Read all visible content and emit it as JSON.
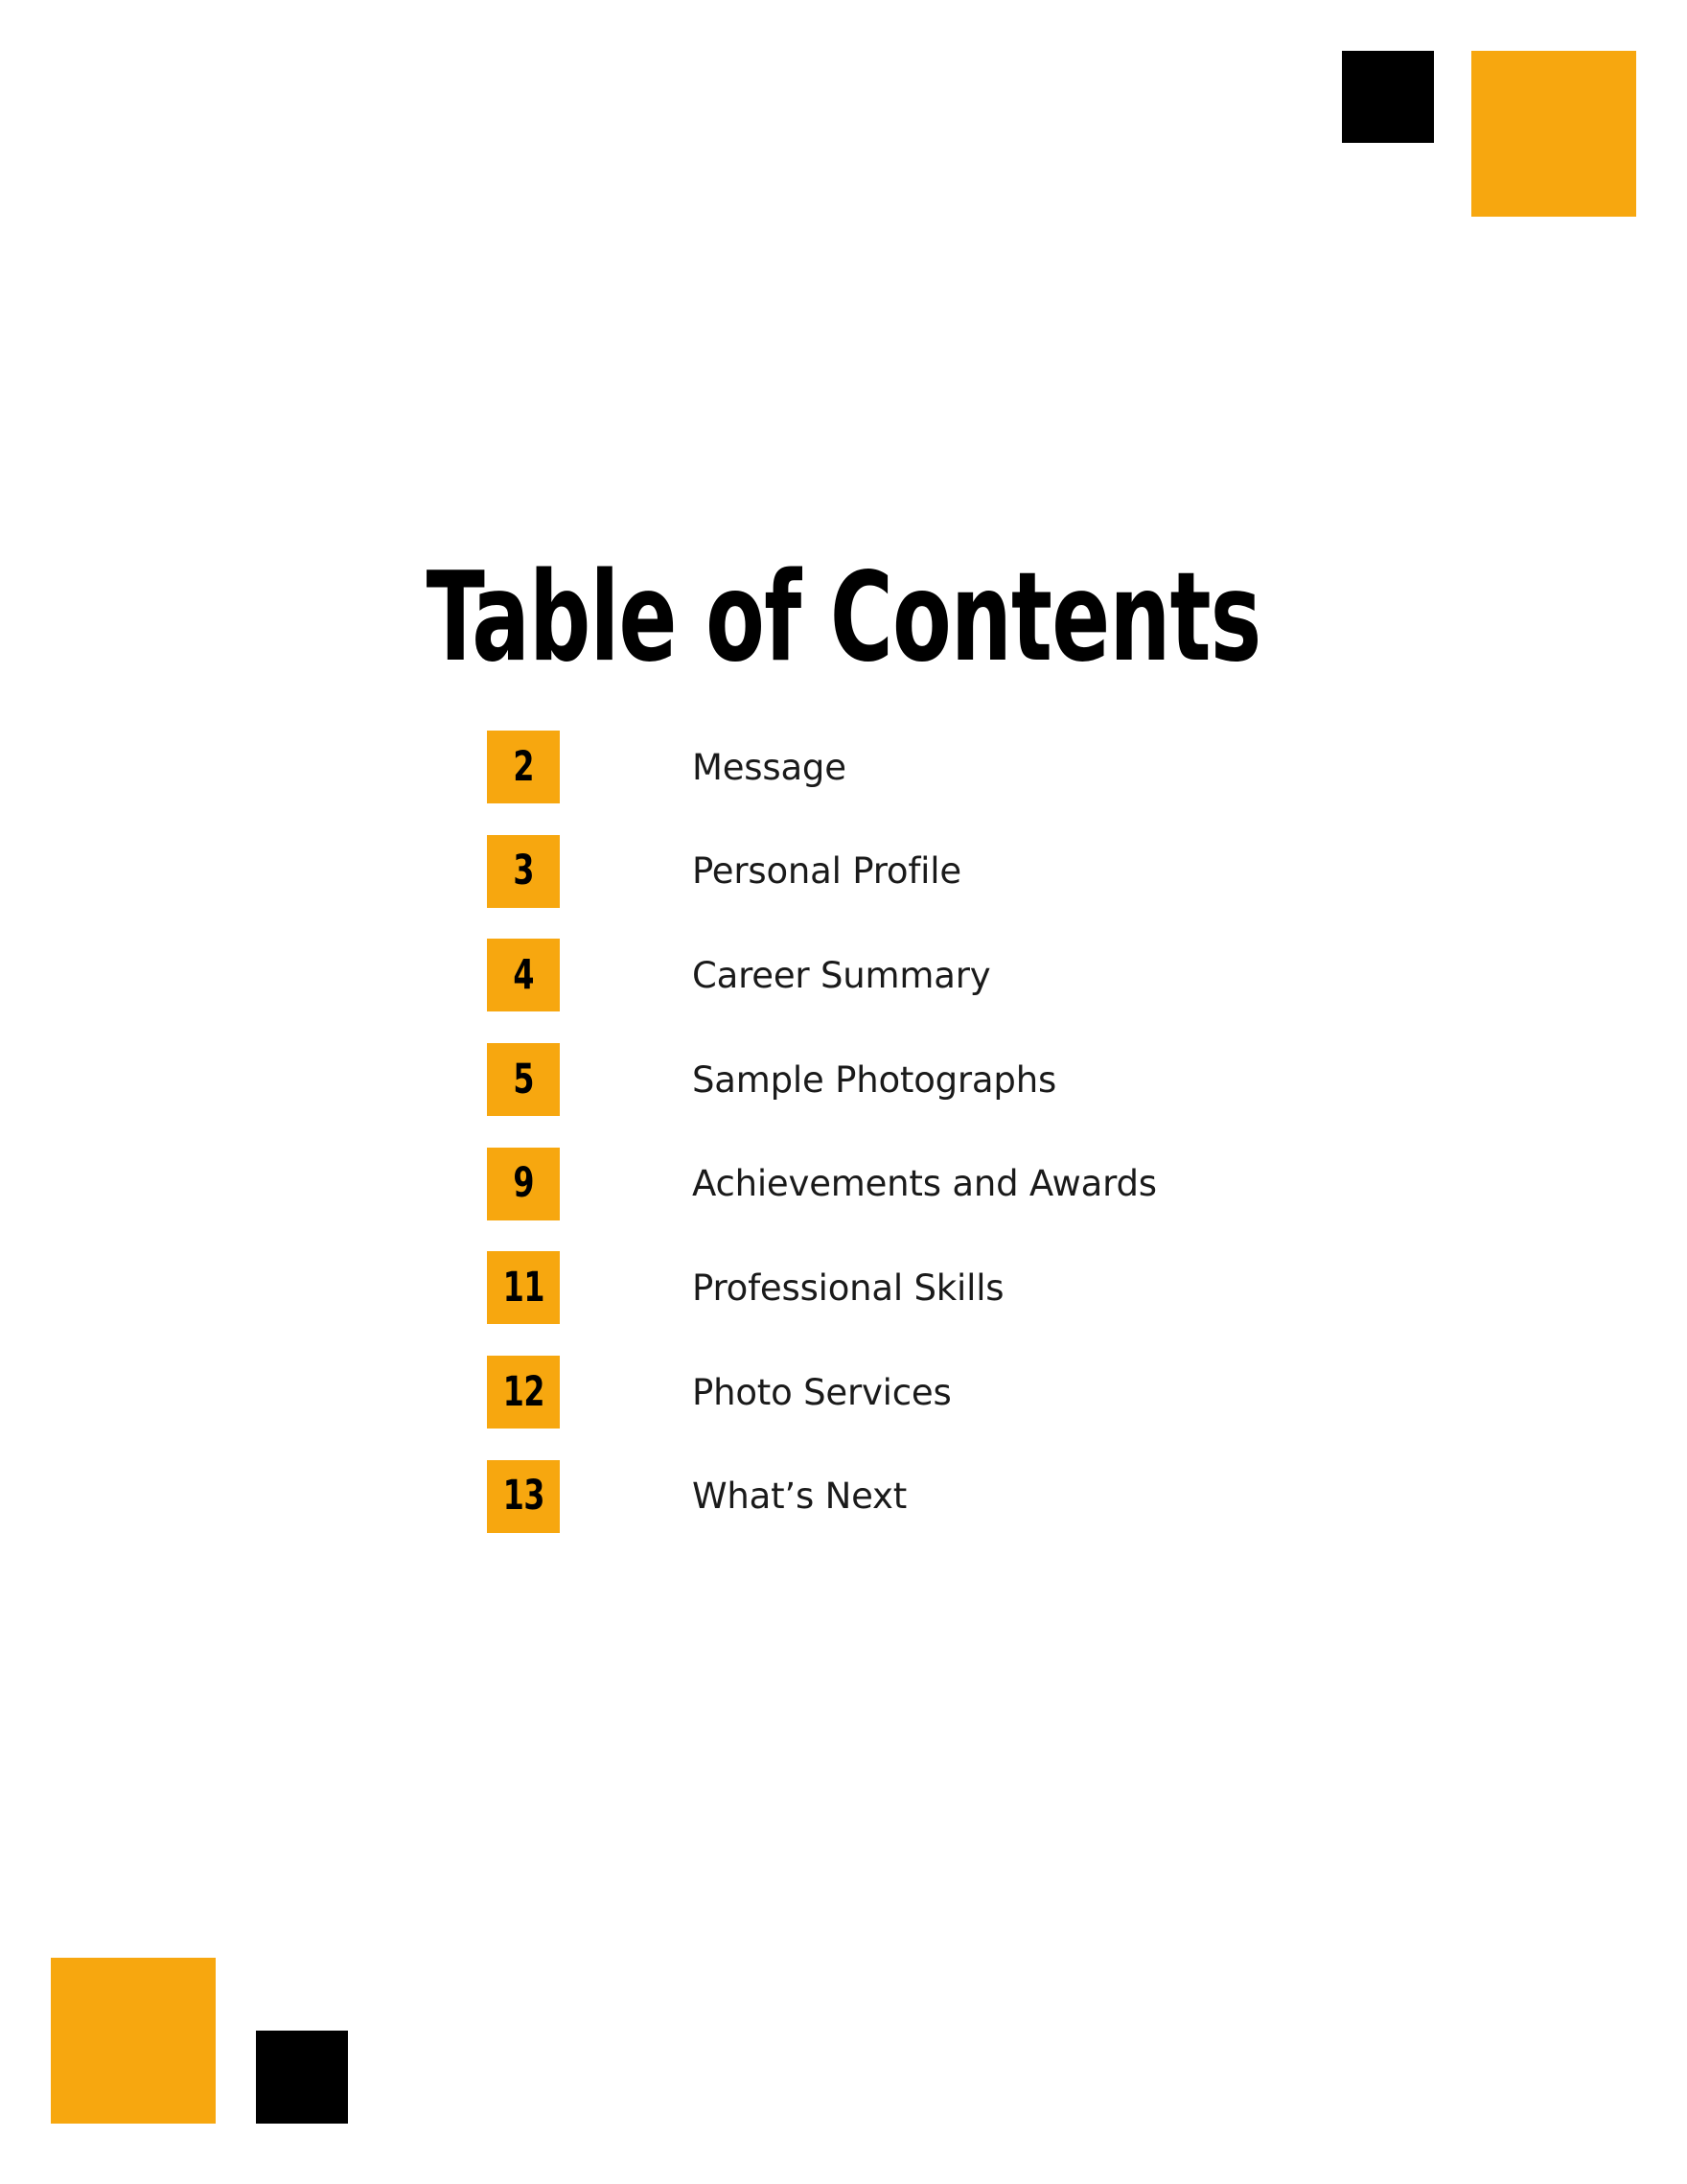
{
  "document": {
    "title": "Table of Contents",
    "background_color": "#FFFFFF"
  },
  "theme": {
    "accent_color": "#F7A70F",
    "dark_color": "#000000",
    "text_color": "#1A1A1A"
  },
  "decorations": [
    {
      "name": "top-right-black-square",
      "color": "#000000"
    },
    {
      "name": "top-right-orange-square",
      "color": "#F7A70F"
    },
    {
      "name": "bottom-left-orange-square",
      "color": "#F7A70F"
    },
    {
      "name": "bottom-left-black-square",
      "color": "#000000"
    }
  ],
  "contents": {
    "items": [
      {
        "page": "2",
        "label": "Message"
      },
      {
        "page": "3",
        "label": "Personal Profile"
      },
      {
        "page": "4",
        "label": "Career Summary"
      },
      {
        "page": "5",
        "label": "Sample Photographs"
      },
      {
        "page": "9",
        "label": "Achievements and Awards"
      },
      {
        "page": "11",
        "label": "Professional Skills"
      },
      {
        "page": "12",
        "label": "Photo Services"
      },
      {
        "page": "13",
        "label": "What’s Next"
      }
    ]
  }
}
